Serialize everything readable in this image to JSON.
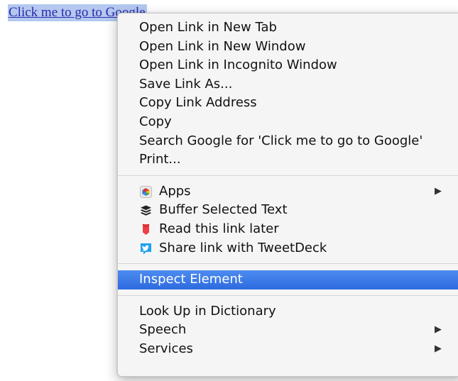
{
  "page": {
    "link_text": "Click me to go to Google"
  },
  "menu": {
    "group1": [
      {
        "label": "Open Link in New Tab"
      },
      {
        "label": "Open Link in New Window"
      },
      {
        "label": "Open Link in Incognito Window"
      },
      {
        "label": "Save Link As..."
      },
      {
        "label": "Copy Link Address"
      },
      {
        "label": "Copy"
      },
      {
        "label": "Search Google for 'Click me to go to Google'"
      },
      {
        "label": "Print..."
      }
    ],
    "group2": [
      {
        "label": "Apps",
        "icon": "apps-icon",
        "submenu": true
      },
      {
        "label": "Buffer Selected Text",
        "icon": "buffer-icon"
      },
      {
        "label": "Read this link later",
        "icon": "pocket-icon"
      },
      {
        "label": "Share link with TweetDeck",
        "icon": "tweetdeck-icon"
      }
    ],
    "group3": [
      {
        "label": "Inspect Element",
        "highlighted": true
      }
    ],
    "group4": [
      {
        "label": "Look Up in Dictionary"
      },
      {
        "label": "Speech",
        "submenu": true
      },
      {
        "label": "Services",
        "submenu": true
      }
    ],
    "submenu_glyph": "▶"
  },
  "colors": {
    "highlight": "#3a78e6",
    "link": "#2a2aa8",
    "link_selection": "#b4c8f0",
    "menu_background": "#f5f5f5"
  }
}
